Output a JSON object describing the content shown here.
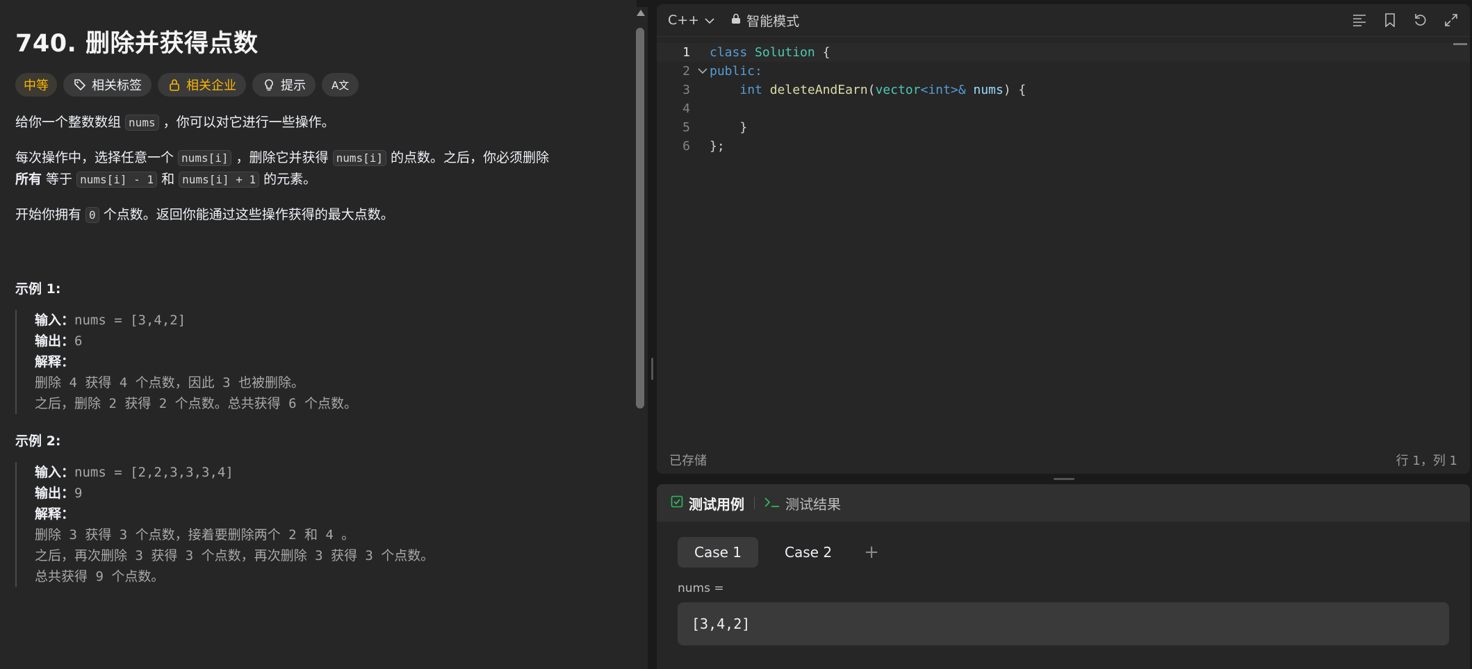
{
  "problem": {
    "title": "740. 删除并获得点数",
    "tags": {
      "difficulty": "中等",
      "related_tags": "相关标签",
      "related_companies": "相关企业",
      "hint": "提示",
      "translate": "A文"
    },
    "desc1": {
      "a": "给你一个整数数组 ",
      "code": "nums",
      "b": " ，你可以对它进行一些操作。"
    },
    "desc2": {
      "a": "每次操作中，选择任意一个 ",
      "code1": "nums[i]",
      "b": " ，删除它并获得 ",
      "code2": "nums[i]",
      "c": " 的点数。之后，你必须删除 ",
      "bold": "所有",
      "d": " 等于 ",
      "code3": "nums[i] - 1",
      "e": " 和 ",
      "code4": "nums[i] + 1",
      "f": " 的元素。"
    },
    "desc3": {
      "a": "开始你拥有 ",
      "code": "0",
      "b": " 个点数。返回你能通过这些操作获得的最大点数。"
    },
    "examples": [
      {
        "title": "示例 1:",
        "input_label": "输入：",
        "input": "nums = [3,4,2]",
        "output_label": "输出：",
        "output": "6",
        "explain_label": "解释：",
        "lines": [
          "删除 4 获得 4 个点数，因此 3 也被删除。",
          "之后，删除 2 获得 2 个点数。总共获得 6 个点数。"
        ]
      },
      {
        "title": "示例 2:",
        "input_label": "输入：",
        "input": "nums = [2,2,3,3,3,4]",
        "output_label": "输出：",
        "output": "9",
        "explain_label": "解释：",
        "lines": [
          "删除 3 获得 3 个点数，接着要删除两个 2 和 4 。",
          "之后，再次删除 3 获得 3 个点数，再次删除 3 获得 3 个点数。",
          "总共获得 9 个点数。"
        ]
      }
    ]
  },
  "editor": {
    "language": "C++",
    "mode": "智能模式",
    "line_numbers": [
      "1",
      "2",
      "3",
      "4",
      "5",
      "6"
    ],
    "code": {
      "l1_kw": "class",
      "l1_ty": "Solution",
      "l1_rest": " {",
      "l2_kw": "public:",
      "l3_kw": "int",
      "l3_fn": "deleteAndEarn",
      "l3_ty": "vector",
      "l3_lt": "<",
      "l3_int": "int",
      "l3_gt": ">",
      "l3_amp": "&",
      "l3_id": "nums",
      "l3_rest": ") {",
      "l5": "    }",
      "l6": "};"
    },
    "status_saved": "已存储",
    "cursor_pos": "行 1，列 1"
  },
  "testpanel": {
    "tab_cases": "测试用例",
    "tab_results": "测试结果",
    "cases": [
      "Case 1",
      "Case 2"
    ],
    "add": "+",
    "param_label": "nums =",
    "param_value": "[3,4,2]"
  }
}
